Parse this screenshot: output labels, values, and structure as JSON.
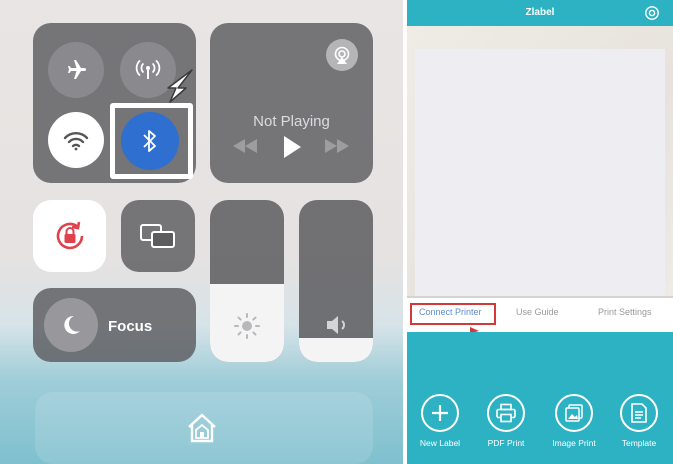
{
  "control_center": {
    "now_playing": {
      "label": "Not Playing"
    },
    "focus": {
      "label": "Focus"
    },
    "brightness_level_percent": 48,
    "volume_level_percent": 15,
    "icons": [
      "airplane-icon",
      "cellular-antenna-icon",
      "wifi-icon",
      "bluetooth-icon",
      "airplay-icon",
      "rewind-icon",
      "play-icon",
      "fast-forward-icon",
      "rotation-lock-icon",
      "screen-mirroring-icon",
      "moon-icon",
      "sun-icon",
      "speaker-icon",
      "home-icon"
    ],
    "colors": {
      "bluetooth_active": "#2f6fd0",
      "rotation_lock": "#e0424c"
    }
  },
  "zlabel_app": {
    "title": "Zlabel",
    "tabs": [
      {
        "label": "Connect Printer",
        "highlighted": true
      },
      {
        "label": "Use Guide"
      },
      {
        "label": "Print Settings"
      }
    ],
    "actions": [
      {
        "label": "New Label",
        "icon": "plus-icon"
      },
      {
        "label": "PDF Print",
        "icon": "printer-icon"
      },
      {
        "label": "Image Print",
        "icon": "image-icon"
      },
      {
        "label": "Template",
        "icon": "document-icon"
      }
    ],
    "colors": {
      "brand": "#2db2c4",
      "highlight": "#d23a3a"
    }
  }
}
